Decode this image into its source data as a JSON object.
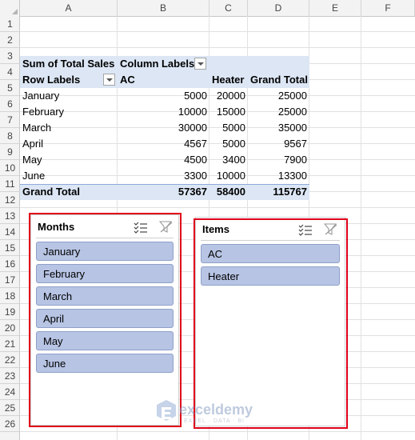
{
  "columns": [
    "A",
    "B",
    "C",
    "D",
    "E",
    "F"
  ],
  "rows": [
    "1",
    "2",
    "3",
    "4",
    "5",
    "6",
    "7",
    "8",
    "9",
    "10",
    "11",
    "12",
    "13",
    "14",
    "15",
    "16",
    "17",
    "18",
    "19",
    "20",
    "21",
    "22",
    "23",
    "24",
    "25",
    "26"
  ],
  "pivot": {
    "value_field": "Sum of Total Sales",
    "column_labels": "Column Labels",
    "row_labels": "Row Labels",
    "col_headers": [
      "AC",
      "Heater",
      "Grand Total"
    ],
    "rows": [
      {
        "label": "January",
        "ac": "5000",
        "heater": "20000",
        "total": "25000"
      },
      {
        "label": "February",
        "ac": "10000",
        "heater": "15000",
        "total": "25000"
      },
      {
        "label": "March",
        "ac": "30000",
        "heater": "5000",
        "total": "35000"
      },
      {
        "label": "April",
        "ac": "4567",
        "heater": "5000",
        "total": "9567"
      },
      {
        "label": "May",
        "ac": "4500",
        "heater": "3400",
        "total": "7900"
      },
      {
        "label": "June",
        "ac": "3300",
        "heater": "10000",
        "total": "13300"
      }
    ],
    "grand_total": {
      "label": "Grand Total",
      "ac": "57367",
      "heater": "58400",
      "total": "115767"
    }
  },
  "slicers": {
    "months": {
      "title": "Months",
      "items": [
        "January",
        "February",
        "March",
        "April",
        "May",
        "June"
      ]
    },
    "items": {
      "title": "Items",
      "items": [
        "AC",
        "Heater"
      ]
    }
  },
  "icons": {
    "multi_select": "multi-select-icon",
    "clear_filter": "clear-filter-icon"
  },
  "colors": {
    "highlight_red": "#e0001a",
    "slicer_item": "#b7c4e4",
    "pivot_band": "#dce6f4"
  },
  "watermark": {
    "brand": "exceldemy",
    "tagline": "EXCEL · DATA · BI"
  }
}
